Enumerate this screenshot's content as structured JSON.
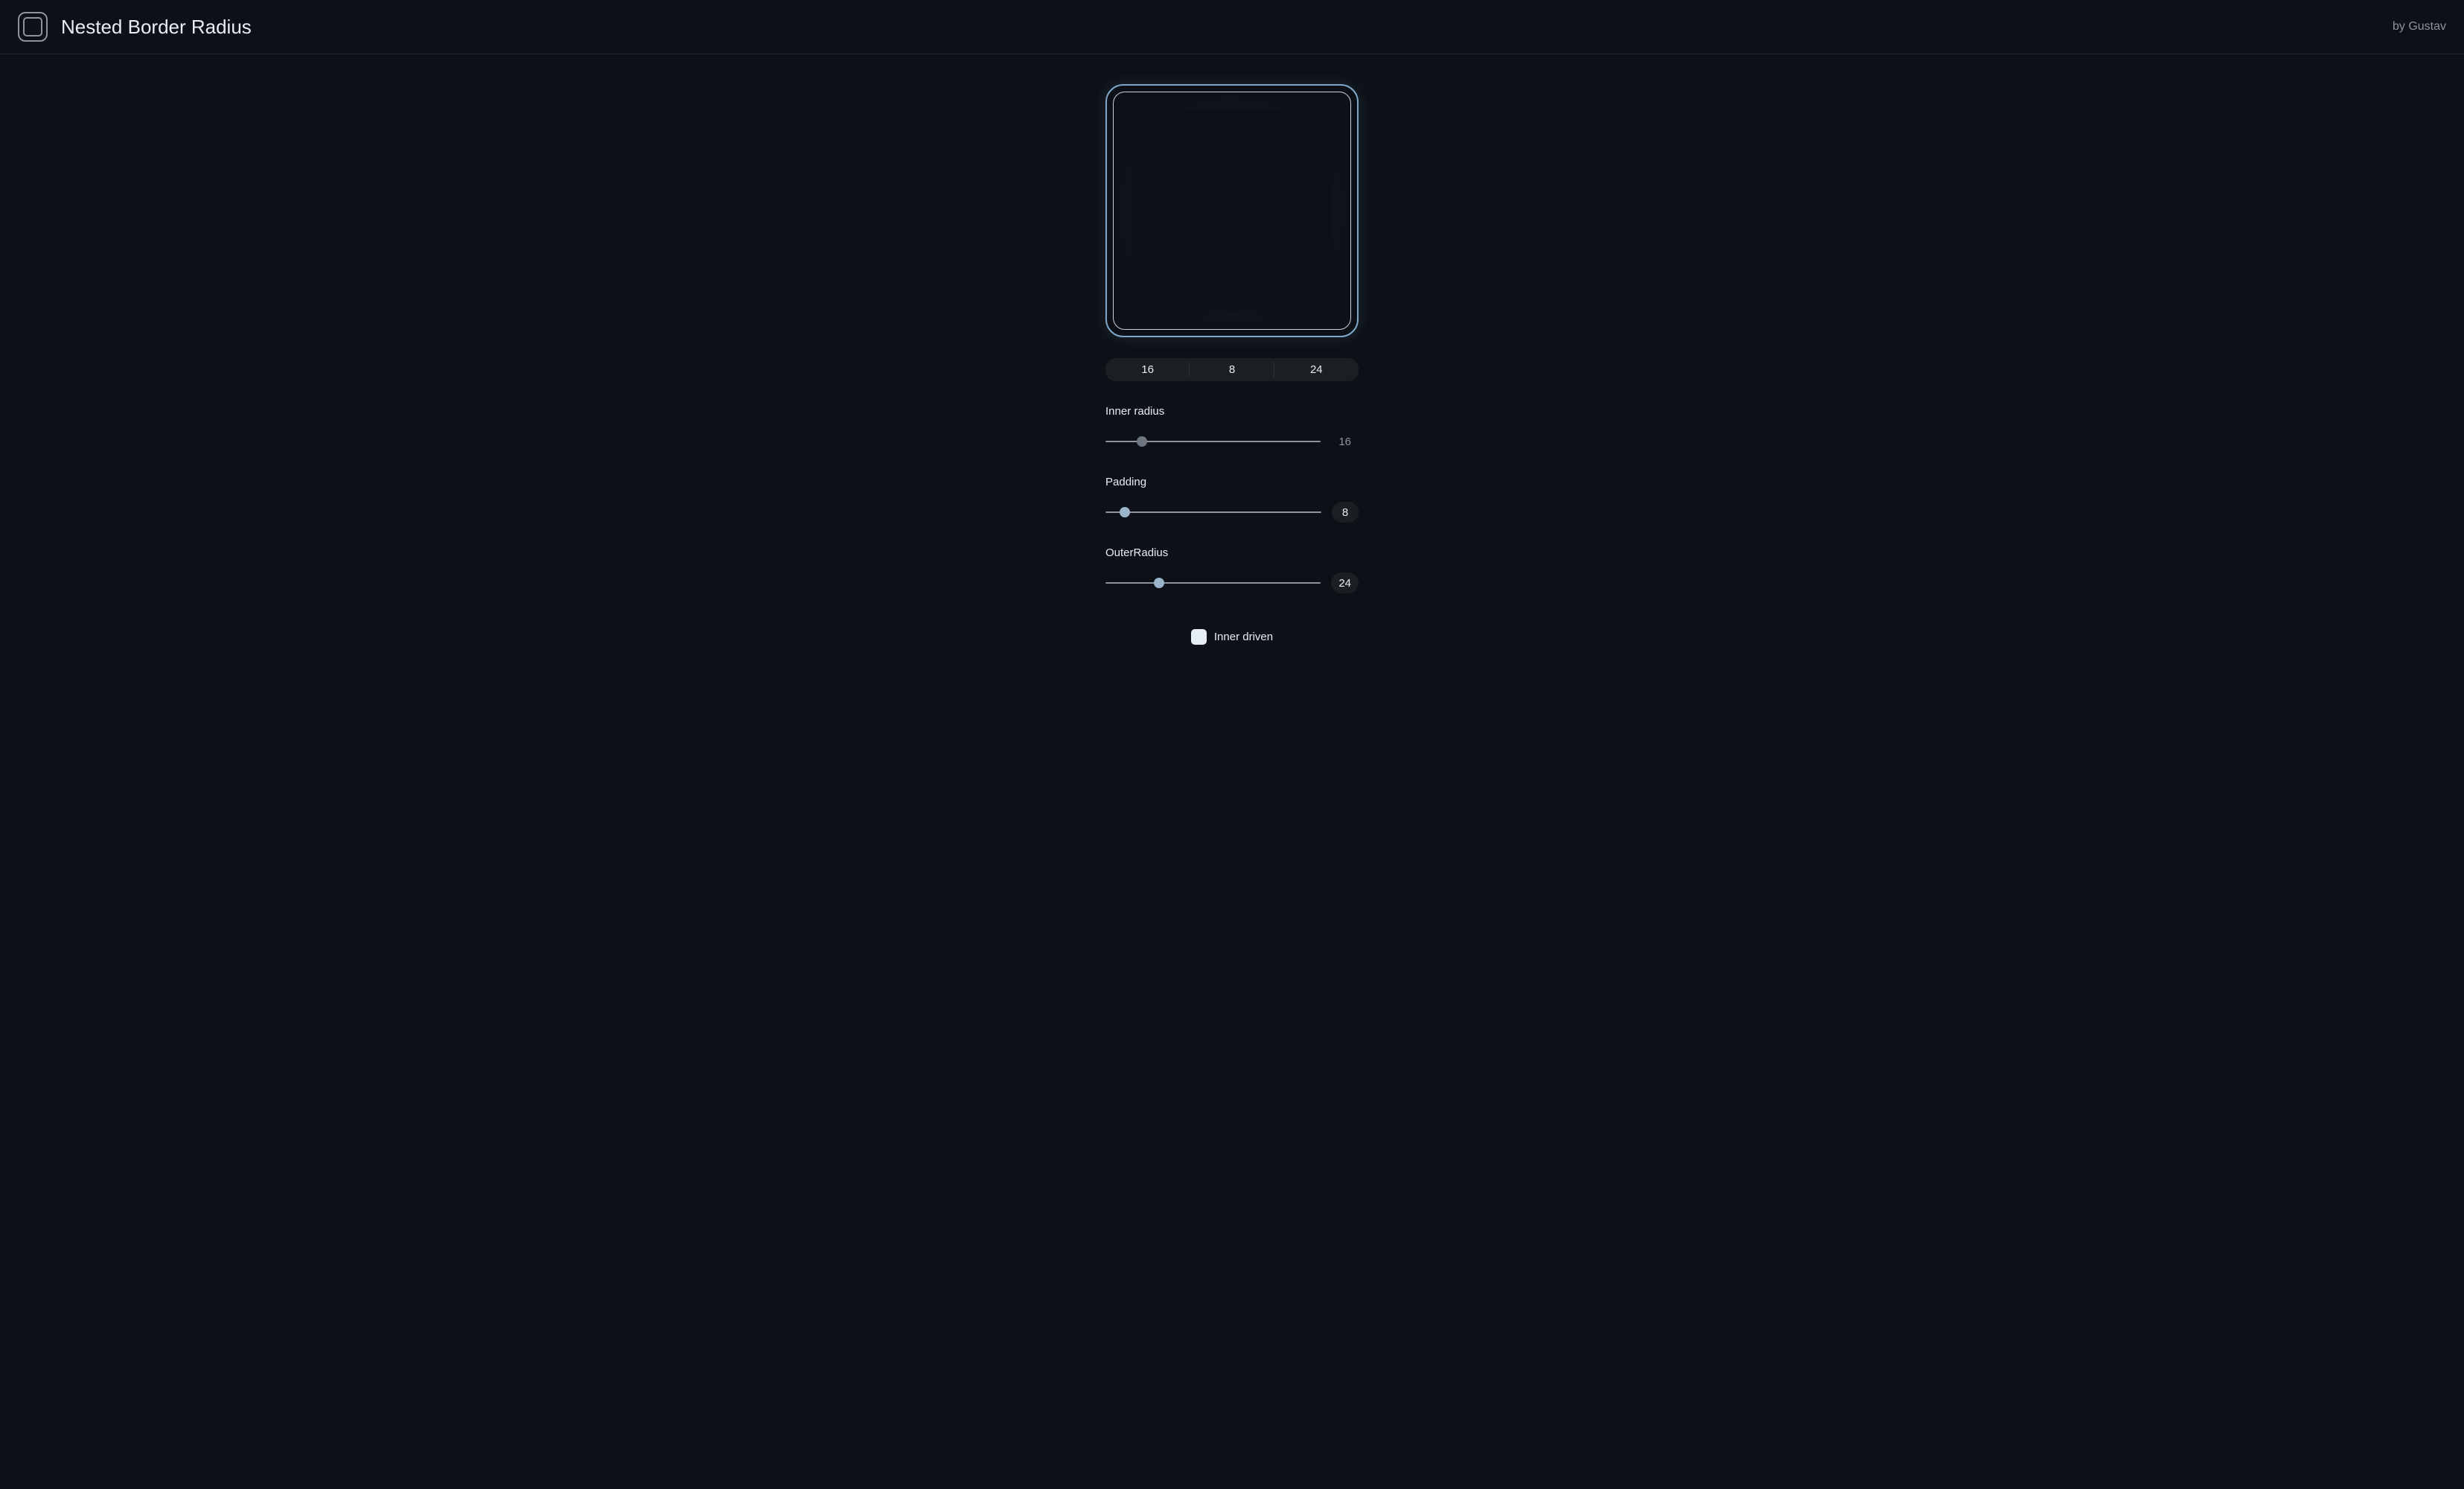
{
  "header": {
    "title": "Nested Border Radius",
    "author": "by Gustav"
  },
  "preview": {
    "outer_radius": 24,
    "inner_radius": 16,
    "padding": 8
  },
  "segmented": {
    "values": [
      "16",
      "8",
      "24"
    ]
  },
  "sliders": {
    "inner_radius": {
      "label": "Inner radius",
      "value": "16",
      "percent": 17,
      "value_style": "plain",
      "thumb_style": "dim"
    },
    "padding": {
      "label": "Padding",
      "value": "8",
      "percent": 9,
      "value_style": "pill",
      "thumb_style": "normal"
    },
    "outer_radius": {
      "label": "OuterRadius",
      "value": "24",
      "percent": 25,
      "value_style": "pill",
      "thumb_style": "normal"
    }
  },
  "checkbox": {
    "label": "Inner driven",
    "checked": false
  }
}
